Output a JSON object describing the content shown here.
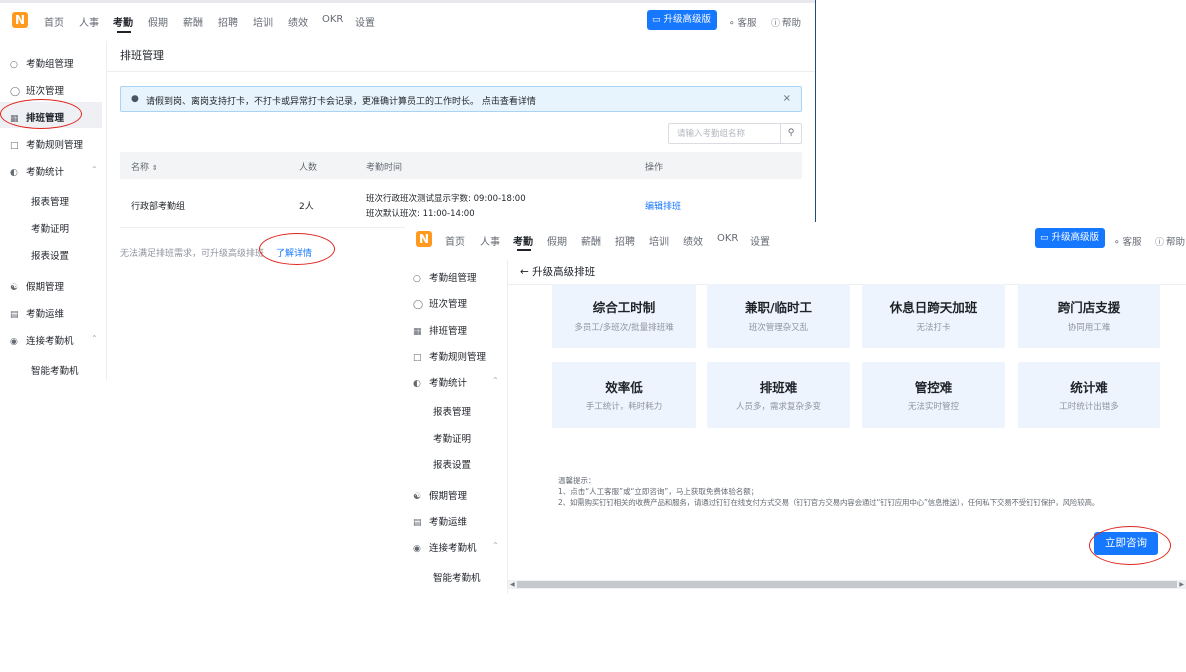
{
  "nav": {
    "logo": "N",
    "items": [
      "首页",
      "人事",
      "考勤",
      "假期",
      "薪酬",
      "招聘",
      "培训",
      "绩效",
      "OKR",
      "设置"
    ],
    "upgrade_label": "升级高级版",
    "service_label": "客服",
    "help_label": "帮助"
  },
  "sidebar": {
    "items": [
      {
        "label": "考勤组管理",
        "icon": "user-icon"
      },
      {
        "label": "班次管理",
        "icon": "users-icon"
      },
      {
        "label": "排班管理",
        "icon": "schedule-icon"
      },
      {
        "label": "考勤规则管理",
        "icon": "rules-icon"
      },
      {
        "label": "考勤统计",
        "icon": "chart-icon"
      },
      {
        "label": "报表管理",
        "icon": ""
      },
      {
        "label": "考勤证明",
        "icon": ""
      },
      {
        "label": "报表设置",
        "icon": ""
      },
      {
        "label": "假期管理",
        "icon": "holiday-icon"
      },
      {
        "label": "考勤运维",
        "icon": "monitor-icon"
      },
      {
        "label": "连接考勤机",
        "icon": "device-icon"
      },
      {
        "label": "智能考勤机",
        "icon": ""
      }
    ]
  },
  "schedule_page": {
    "title": "排班管理",
    "notice": "请假到岗、离岗支持打卡，不打卡或异常打卡会记录，更准确计算员工的工作时长。 点击查看详情",
    "search_placeholder": "请输入考勤组名称",
    "columns": [
      "名称",
      "人数",
      "考勤时间",
      "操作"
    ],
    "rows": [
      {
        "name": "行政部考勤组",
        "count": "2人",
        "time_line1": "班次行政班次测试显示字数: 09:00-18:00",
        "time_line2": "班次默认班次: 11:00-14:00",
        "action": "编辑排班"
      }
    ],
    "footer_note": "无法满足排班需求，可升级高级排班",
    "footer_link": "了解详情"
  },
  "upgrade_page": {
    "title": "升级高级排班",
    "cards": [
      {
        "title": "综合工时制",
        "subtitle": "多员工/多班次/批量排班难"
      },
      {
        "title": "兼职/临时工",
        "subtitle": "班次管理杂又乱"
      },
      {
        "title": "休息日跨天加班",
        "subtitle": "无法打卡"
      },
      {
        "title": "跨门店支援",
        "subtitle": "协同用工难"
      },
      {
        "title": "效率低",
        "subtitle": "手工统计，耗时耗力"
      },
      {
        "title": "排班难",
        "subtitle": "人员多，需求复杂多变"
      },
      {
        "title": "管控难",
        "subtitle": "无法实时管控"
      },
      {
        "title": "统计难",
        "subtitle": "工时统计出错多"
      }
    ],
    "tips_title": "温馨提示：",
    "tips_1": "1、点击“人工客服”或“立即咨询”，马上获取免费体验名额；",
    "tips_2": "2、如需购买钉钉相关的收费产品和服务，请通过钉钉在线支付方式交易（钉钉官方交易内容会通过“钉钉应用中心”信息推送），任何私下交易不受钉钉保护，风险较高。",
    "consult_label": "立即咨询"
  },
  "colors": {
    "accent": "#1677ff",
    "annotation": "#e0261f",
    "logo": "#ff9a1f"
  }
}
